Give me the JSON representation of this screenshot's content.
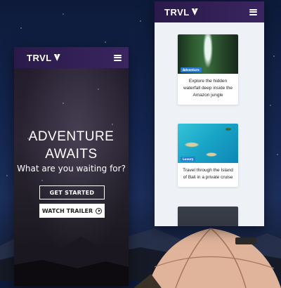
{
  "brand": {
    "logo_text": "TRVL",
    "logo_mark": "V"
  },
  "hero": {
    "title_line1": "ADVENTURE",
    "title_line2": "AWAITS",
    "subtitle": "What are you waiting for?",
    "primary_button": "GET STARTED",
    "secondary_button": "WATCH TRAILER",
    "secondary_icon": "play-circle-icon"
  },
  "cards": [
    {
      "badge": "Adventure",
      "text": "Explore the hidden waterfall deep inside the Amazon jungle"
    },
    {
      "badge": "Luxury",
      "text": "Travel through the Island of Bali in a private cruise"
    }
  ],
  "colors": {
    "nav_start": "#2a1a4a",
    "nav_end": "#3a2560",
    "badge": "#2a7bd6"
  }
}
